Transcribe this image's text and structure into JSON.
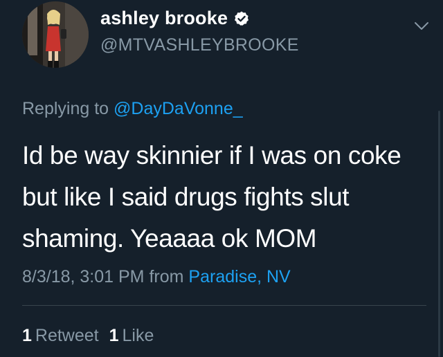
{
  "user": {
    "display_name": "ashley brooke",
    "handle": "@MTVASHLEYBROOKE",
    "verified_icon": "verified-badge-icon",
    "avatar": "profile-photo"
  },
  "reply": {
    "prefix": "Replying to",
    "mention": "@DayDaVonne_"
  },
  "tweet": {
    "line1": "Id be way skinnier if I was on coke",
    "line2": "but like I said drugs fights slut",
    "line3": "shaming. Yeaaaa ok MOM"
  },
  "meta": {
    "timestamp": "8/3/18, 3:01 PM",
    "from_label": "from",
    "location": "Paradise, NV"
  },
  "stats": {
    "retweet_count": "1",
    "retweet_label": "Retweet",
    "like_count": "1",
    "like_label": "Like"
  },
  "colors": {
    "background": "#15202b",
    "accent": "#1da1f2",
    "muted": "#8899a6"
  }
}
